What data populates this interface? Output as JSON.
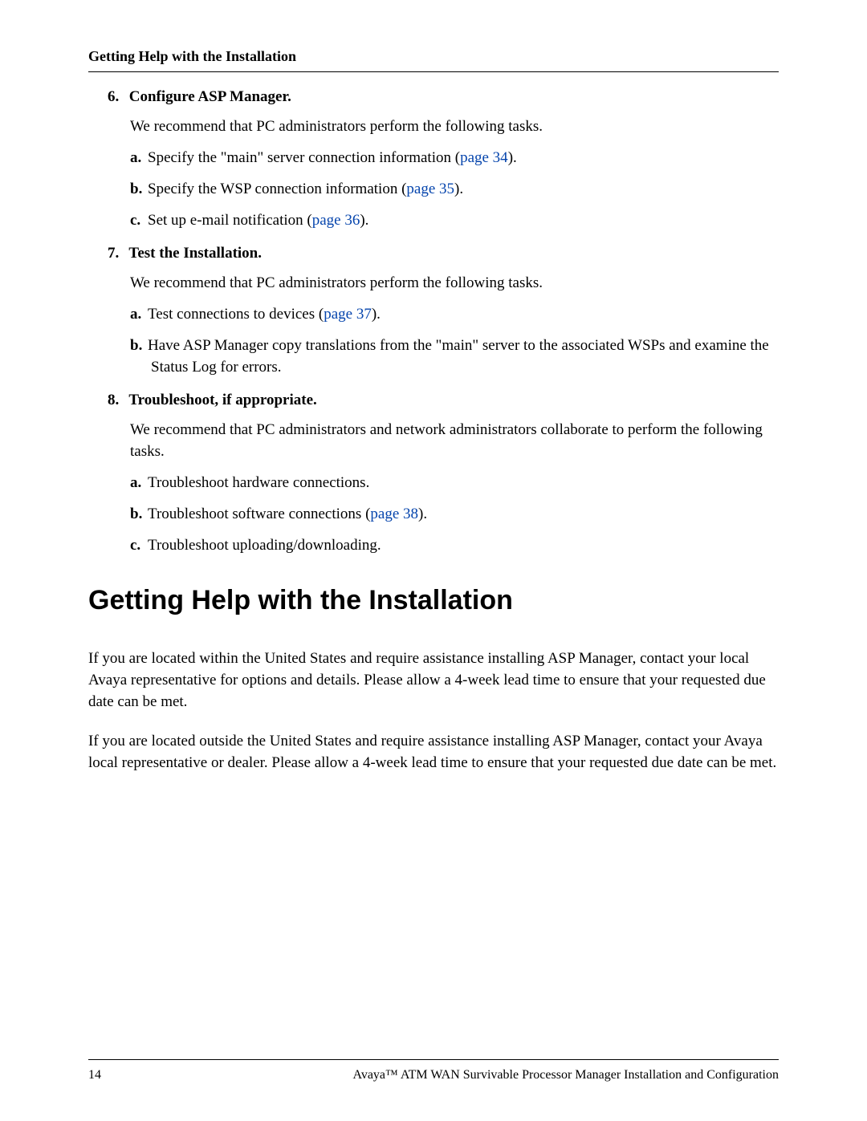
{
  "header": {
    "running_title": "Getting Help with the Installation"
  },
  "steps": [
    {
      "num": "6.",
      "title": "Configure ASP Manager.",
      "intro": "We recommend that PC administrators perform the following tasks.",
      "subs": [
        {
          "marker": "a.",
          "before": "Specify the \"main\" server connection information (",
          "link": "page 34",
          "after": ")."
        },
        {
          "marker": "b.",
          "before": "Specify the WSP connection information (",
          "link": "page 35",
          "after": ")."
        },
        {
          "marker": "c.",
          "before": "Set up e-mail notification (",
          "link": "page 36",
          "after": ")."
        }
      ]
    },
    {
      "num": "7.",
      "title": "Test the Installation.",
      "intro": "We recommend that PC administrators perform the following tasks.",
      "subs": [
        {
          "marker": "a.",
          "before": "Test connections to devices (",
          "link": "page 37",
          "after": ")."
        },
        {
          "marker": "b.",
          "before": "Have ASP Manager copy translations from the \"main\" server to the associated WSPs and examine the Status Log for errors.",
          "link": "",
          "after": ""
        }
      ]
    },
    {
      "num": "8.",
      "title": "Troubleshoot, if appropriate.",
      "intro": "We recommend that PC administrators and network administrators collaborate to perform the following tasks.",
      "subs": [
        {
          "marker": "a.",
          "before": "Troubleshoot hardware connections.",
          "link": "",
          "after": ""
        },
        {
          "marker": "b.",
          "before": "Troubleshoot software connections (",
          "link": "page 38",
          "after": ")."
        },
        {
          "marker": "c.",
          "before": "Troubleshoot uploading/downloading.",
          "link": "",
          "after": ""
        }
      ]
    }
  ],
  "main": {
    "heading": "Getting Help with the Installation",
    "paragraphs": [
      "If you are located within the United States and require assistance installing ASP Manager, contact your local Avaya representative for options and details. Please allow a 4-week lead time to ensure that your requested due date can be met.",
      "If you are located outside the United States and require assistance installing ASP Manager, contact your Avaya local representative or dealer. Please allow a 4-week lead time to ensure that your requested due date can be met."
    ]
  },
  "footer": {
    "page_number": "14",
    "doc_title": "Avaya™ ATM WAN Survivable Processor Manager Installation and Configuration"
  }
}
